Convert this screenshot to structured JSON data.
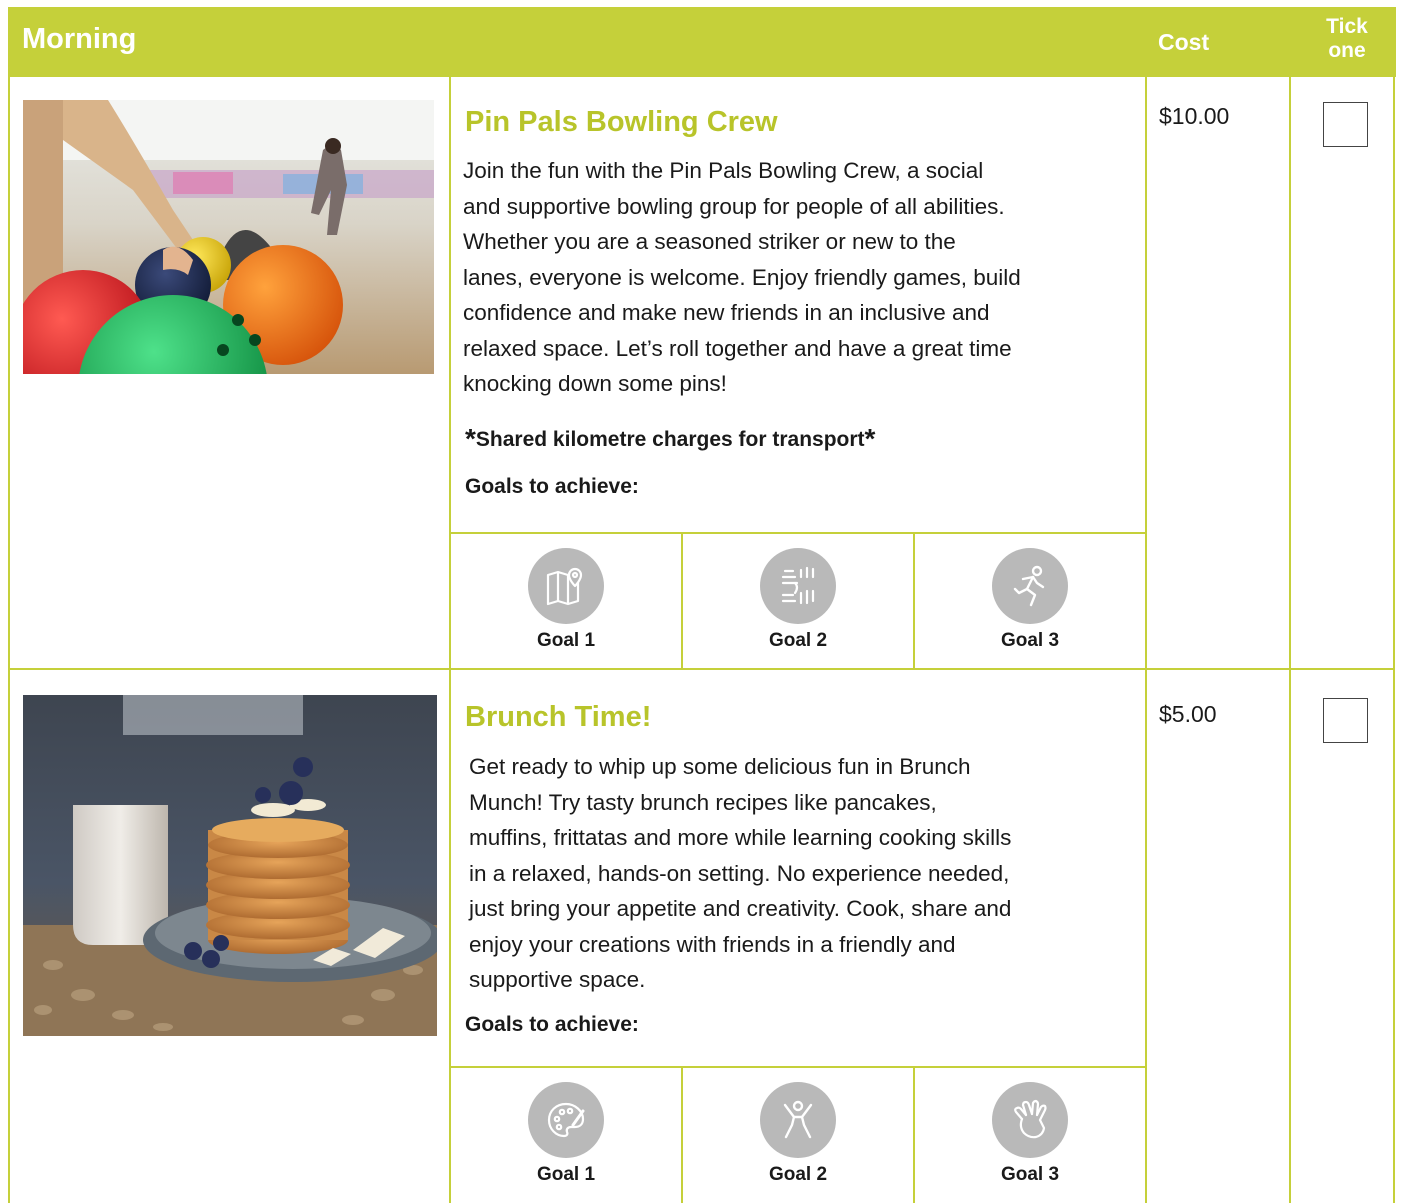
{
  "header": {
    "section": "Morning",
    "cost_label": "Cost",
    "tick_label_line1": "Tick",
    "tick_label_line2": "one"
  },
  "activities": [
    {
      "image": "bowling-photo",
      "title": "Pin Pals Bowling Crew",
      "lines": [
        "Join the fun with the Pin Pals Bowling Crew, a social",
        "and supportive bowling group for people of all abilities.",
        "Whether you are a seasoned striker or new to the",
        "lanes, everyone is welcome. Enjoy friendly games, build",
        "confidence and make new friends in an inclusive and",
        "relaxed space. Let’s roll together and have a great time",
        "knocking down some pins!"
      ],
      "note": "Shared kilometre charges for transport",
      "note_star": "*",
      "goals_label": "Goals to achieve:",
      "goals": [
        {
          "label": "Goal 1",
          "icon": "map-pin-icon"
        },
        {
          "label": "Goal 2",
          "icon": "hands-together-icon"
        },
        {
          "label": "Goal 3",
          "icon": "running-person-icon"
        }
      ],
      "cost": "$10.00"
    },
    {
      "image": "pancakes-photo",
      "title": "Brunch Time!",
      "lines": [
        "Get ready to whip up some delicious fun in Brunch",
        "Munch! Try tasty brunch recipes like pancakes,",
        "muffins, frittatas and more while learning cooking skills",
        "in a relaxed, hands-on setting. No experience needed,",
        "just bring your appetite and creativity. Cook, share and",
        "enjoy your creations with friends in a friendly and",
        "supportive space."
      ],
      "goals_label": "Goals to achieve:",
      "goals": [
        {
          "label": "Goal 1",
          "icon": "paint-palette-icon"
        },
        {
          "label": "Goal 2",
          "icon": "stretching-person-icon"
        },
        {
          "label": "Goal 3",
          "icon": "hand-gesture-icon"
        }
      ],
      "cost": "$5.00"
    }
  ],
  "colors": {
    "accent": "#c5d03a",
    "title": "#b8c42a",
    "icon_circle": "#b9b9b9"
  }
}
